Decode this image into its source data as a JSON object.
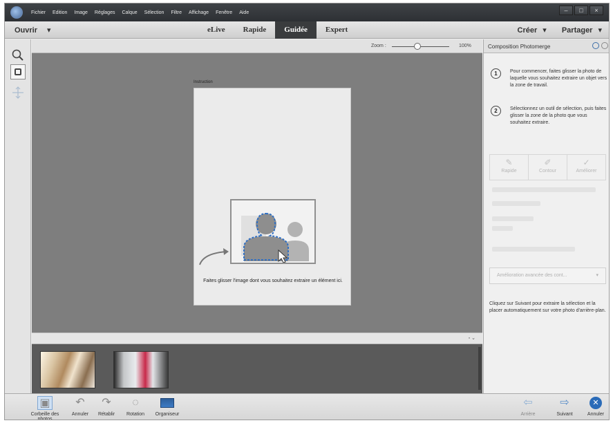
{
  "menubar": {
    "items": [
      "Fichier",
      "Edition",
      "Image",
      "Réglages",
      "Calque",
      "Sélection",
      "Filtre",
      "Affichage",
      "Fenêtre",
      "Aide"
    ],
    "window_controls": [
      "–",
      "□",
      "×"
    ]
  },
  "modebar": {
    "open_label": "Ouvrir",
    "tabs": [
      {
        "label": "eLive",
        "active": false
      },
      {
        "label": "Rapide",
        "active": false
      },
      {
        "label": "Guidée",
        "active": true
      },
      {
        "label": "Expert",
        "active": false
      }
    ],
    "create_label": "Créer",
    "share_label": "Partager"
  },
  "zoom": {
    "label": "Zoom :",
    "value": "100%",
    "level": 0.45
  },
  "canvas": {
    "instruction_label": "Instruction",
    "drop_text": "Faites glisser l'image dont vous souhaitez extraire un élément ici."
  },
  "bin": {
    "controls": "▫ ⌄"
  },
  "panel": {
    "title": "Composition Photomerge",
    "steps": [
      {
        "num": "1",
        "text": "Pour commencer, faites glisser la photo de laquelle vous souhaitez extraire un objet vers la zone de travail."
      },
      {
        "num": "2",
        "text": "Sélectionnez un outil de sélection, puis faites glisser la zone de la photo que vous souhaitez extraire."
      }
    ],
    "tools": [
      "Rapide",
      "Contour",
      "Améliorer"
    ],
    "refine_label": "Amélioration avancée des cont...",
    "hint": "Cliquez sur Suivant pour extraire la sélection et la placer automatiquement sur votre photo d'arrière-plan."
  },
  "taskbar": {
    "photo_bin": "Corbeille des photos",
    "undo": "Annuler",
    "redo": "Rétablir",
    "rotate": "Rotation",
    "organizer": "Organiseur",
    "back": "Arrière",
    "next": "Suivant",
    "cancel": "Annuler"
  }
}
